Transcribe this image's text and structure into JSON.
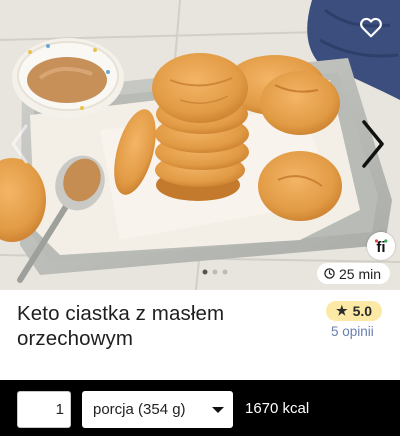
{
  "recipe": {
    "title": "Keto ciastka z masłem orzechowym",
    "time": "25 min",
    "rating": "5.0",
    "reviews": "5 opinii",
    "brand_logo": "fi"
  },
  "portion": {
    "quantity": "1",
    "unit": "porcja (354 g)",
    "calories": "1670 kcal"
  },
  "icons": {
    "favorite": "heart-outline-icon",
    "prev": "chevron-left-icon",
    "next": "chevron-right-icon",
    "clock": "clock-icon",
    "star": "star-icon",
    "dropdown": "caret-down-icon"
  },
  "colors": {
    "rating_badge": "#fde9a6",
    "reviews_link": "#6b7fae",
    "bottom_bar": "#000000"
  }
}
